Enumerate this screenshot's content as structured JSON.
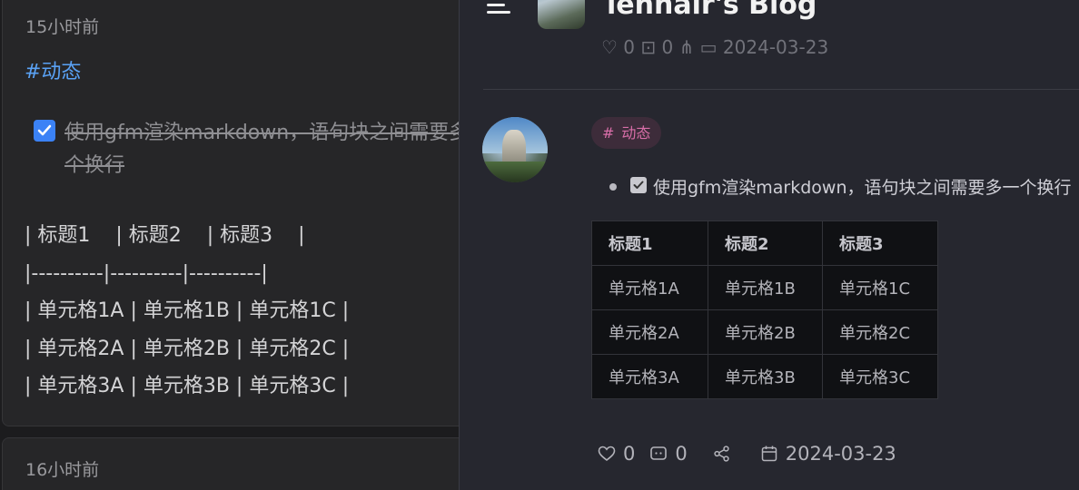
{
  "left_pane": {
    "memo1": {
      "time": "15小时前",
      "tag": "#动态",
      "todo_text": "使用gfm渲染markdown，语句块之间需要多一个换行",
      "raw_lines": [
        "| 标题1    | 标题2    | 标题3    |",
        "|----------|----------|----------|",
        "| 单元格1A | 单元格1B | 单元格1C |",
        "| 单元格2A | 单元格2B | 单元格2C |",
        "| 单元格3A | 单元格3B | 单元格3C |"
      ]
    },
    "memo2": {
      "time": "16小时前"
    }
  },
  "drawer": {
    "blog_title": "lehhair's Blog",
    "ghost_meta": "♡ 0   ⊡ 0   ⋔   ▭ 2024-03-23",
    "post": {
      "tag": "动态",
      "task_text": "使用gfm渲染markdown，语句块之间需要多一个换行",
      "table": {
        "headers": [
          "标题1",
          "标题2",
          "标题3"
        ],
        "rows": [
          [
            "单元格1A",
            "单元格1B",
            "单元格1C"
          ],
          [
            "单元格2A",
            "单元格2B",
            "单元格2C"
          ],
          [
            "单元格3A",
            "单元格3B",
            "单元格3C"
          ]
        ]
      },
      "likes": "0",
      "comments": "0",
      "date": "2024-03-23"
    }
  },
  "colors": {
    "tag_blue": "#5aa2f5",
    "checkbox_blue": "#3b82f6",
    "tag_pink": "#d86ea8",
    "drawer_bg": "#26272f"
  }
}
